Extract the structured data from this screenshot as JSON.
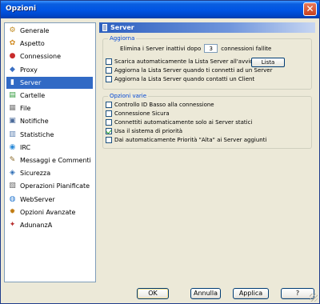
{
  "window": {
    "title": "Opzioni"
  },
  "sidebar": {
    "selected_index": 4,
    "items": [
      {
        "label": "Generale",
        "icon": "gear-icon",
        "glyph": "⚙",
        "color": "#c08a1e"
      },
      {
        "label": "Aspetto",
        "icon": "palette-icon",
        "glyph": "✿",
        "color": "#d08a20"
      },
      {
        "label": "Connessione",
        "icon": "connection-icon",
        "glyph": "●",
        "color": "#c82b2b"
      },
      {
        "label": "Proxy",
        "icon": "proxy-icon",
        "glyph": "◆",
        "color": "#3a6fc2"
      },
      {
        "label": "Server",
        "icon": "server-icon",
        "glyph": "▮",
        "color": "#6a7fb5"
      },
      {
        "label": "Cartelle",
        "icon": "folder-icon",
        "glyph": "▤",
        "color": "#2f9a3a"
      },
      {
        "label": "File",
        "icon": "file-icon",
        "glyph": "▦",
        "color": "#7a7a7a"
      },
      {
        "label": "Notifiche",
        "icon": "notification-icon",
        "glyph": "▣",
        "color": "#4a6a9a"
      },
      {
        "label": "Statistiche",
        "icon": "statistics-icon",
        "glyph": "▥",
        "color": "#5a7fb0"
      },
      {
        "label": "IRC",
        "icon": "irc-icon",
        "glyph": "◉",
        "color": "#2a8ad8"
      },
      {
        "label": "Messaggi e Commenti",
        "icon": "messages-icon",
        "glyph": "✎",
        "color": "#8a6a2a"
      },
      {
        "label": "Sicurezza",
        "icon": "shield-icon",
        "glyph": "◈",
        "color": "#2d6db5"
      },
      {
        "label": "Operazioni Pianificate",
        "icon": "scheduler-icon",
        "glyph": "▧",
        "color": "#6a6a6a"
      },
      {
        "label": "WebServer",
        "icon": "globe-icon",
        "glyph": "◍",
        "color": "#2a7ad0"
      },
      {
        "label": "Opzioni Avanzate",
        "icon": "advanced-options-icon",
        "glyph": "✹",
        "color": "#c07a10"
      },
      {
        "label": "AdunanzA",
        "icon": "adunanza-icon",
        "glyph": "✦",
        "color": "#b83030"
      }
    ]
  },
  "panel": {
    "title": "Server",
    "icon": "server-icon",
    "aggiorna": {
      "title": "Aggiorna",
      "remove_prefix": "Elimina i Server inattivi dopo",
      "remove_value": "3",
      "remove_suffix": "connessioni fallite",
      "checks": [
        {
          "label": "Scarica automaticamente la Lista Server all'avvio",
          "checked": false
        },
        {
          "label": "Aggiorna la Lista Server quando ti connetti ad un Server",
          "checked": false
        },
        {
          "label": "Aggiorna la Lista Server quando contatti un Client",
          "checked": false
        }
      ],
      "list_button": "Lista"
    },
    "opzioni_varie": {
      "title": "Opzioni varie",
      "checks": [
        {
          "label": "Controllo ID Basso alla connessione",
          "checked": false
        },
        {
          "label": "Connessione Sicura",
          "checked": false
        },
        {
          "label": "Connettiti automaticamente solo ai Server statici",
          "checked": false
        },
        {
          "label": "Usa il sistema di priorità",
          "checked": true
        },
        {
          "label": "Dai automaticamente Priorità \"Alta\" ai Server aggiunti",
          "checked": false
        }
      ]
    }
  },
  "buttons": {
    "ok": "OK",
    "cancel": "Annulla",
    "apply": "Applica",
    "help": "?"
  }
}
